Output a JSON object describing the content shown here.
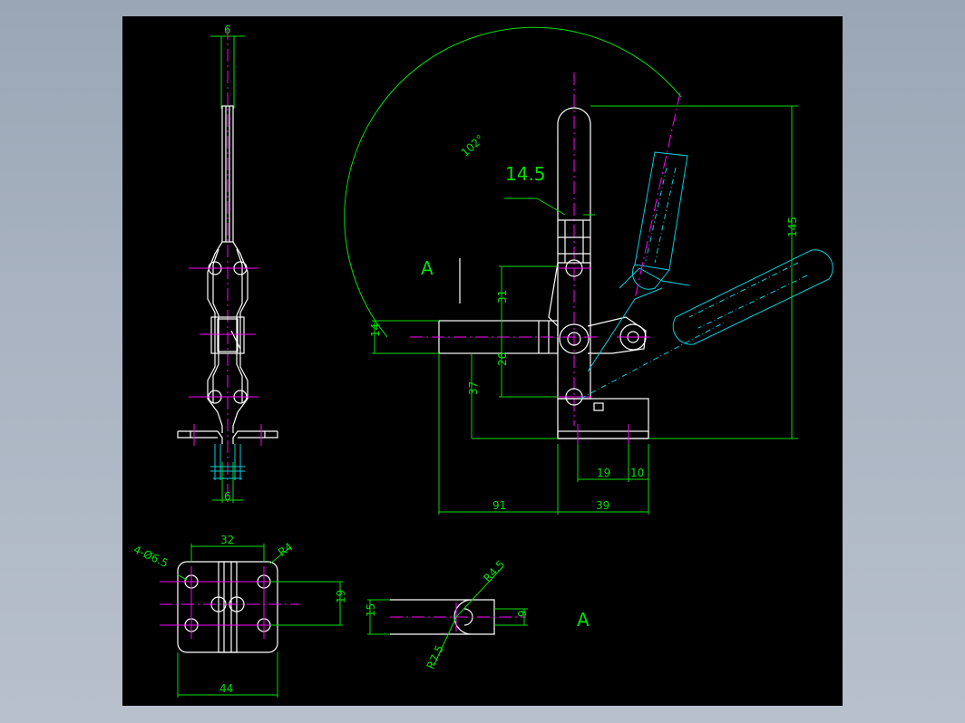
{
  "colors": {
    "background": "#000000",
    "outline": "#ffffff",
    "dimension": "#00e000",
    "centerline": "#ff00ff",
    "phantom": "#00d0e0"
  },
  "side_view": {
    "top_width": "6",
    "bottom_width": "6"
  },
  "front_view": {
    "angle": "102°",
    "handle_width": "14.5",
    "view_letter": "A",
    "height_total": "145",
    "dim_31": "31",
    "dim_26": "26",
    "dim_37": "37",
    "dim_14": "14",
    "dim_19": "19",
    "dim_10": "10",
    "dim_91": "91",
    "dim_39": "39"
  },
  "base_view": {
    "width_top": "32",
    "corner_radius": "R4",
    "holes": "4-Ø6.5",
    "hole_spacing": "19",
    "width_bottom": "44"
  },
  "detail_a": {
    "radius_small": "R4.5",
    "radius_large": "R7.5",
    "height": "15",
    "slot": "9",
    "view_letter": "A"
  }
}
